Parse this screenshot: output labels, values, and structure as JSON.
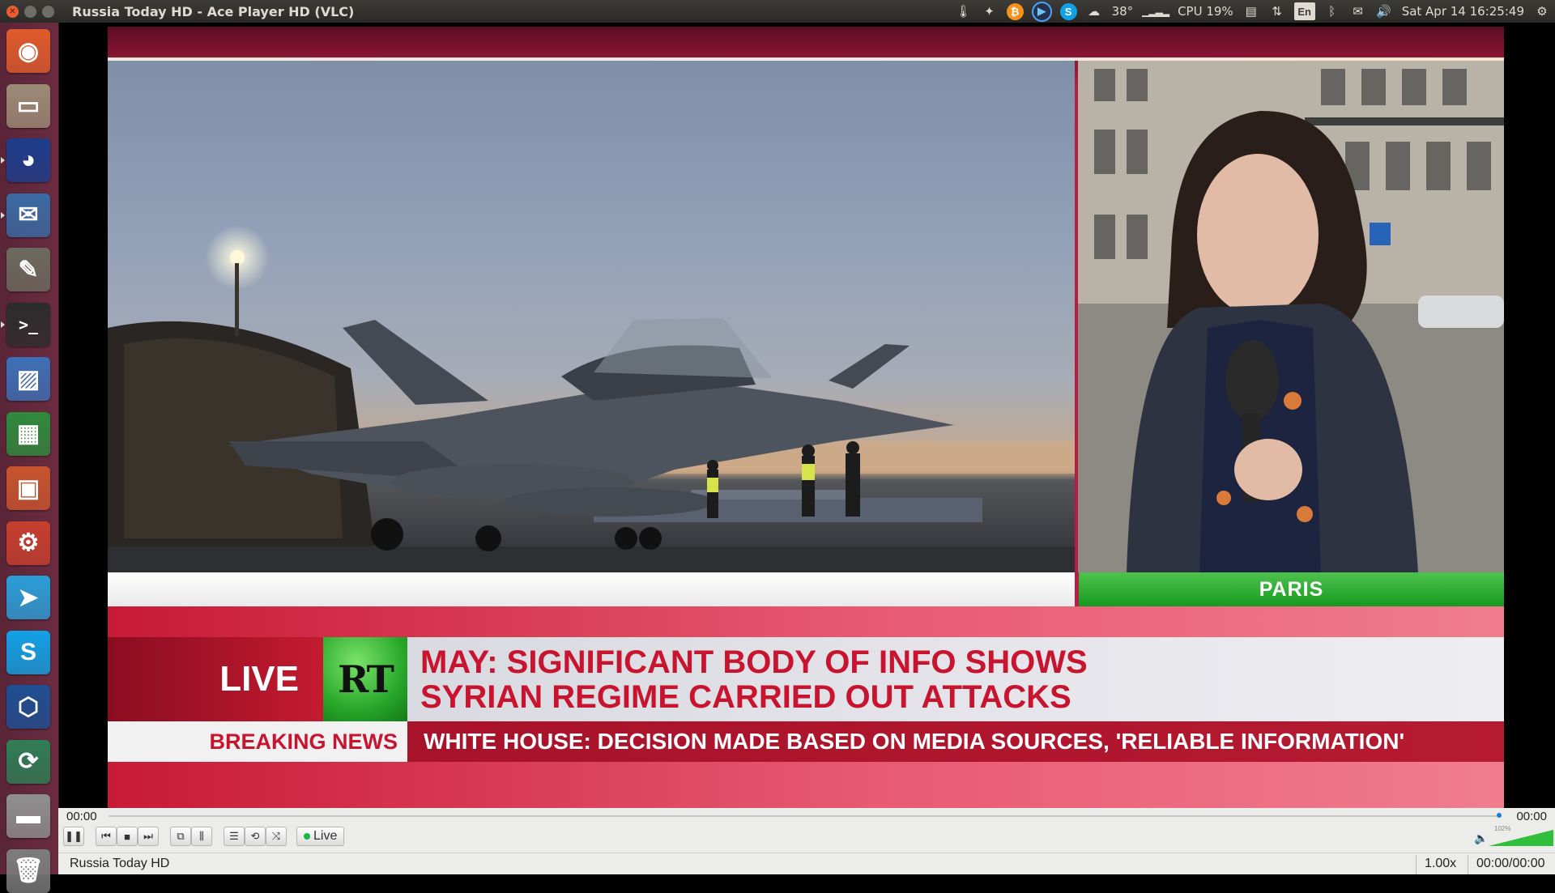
{
  "window": {
    "title": "Russia Today HD - Ace Player HD (VLC)"
  },
  "tray": {
    "weather_temp": "38°",
    "cpu": "CPU 19%",
    "keyboard_layout": "En",
    "datetime": "Sat Apr 14 16:25:49"
  },
  "launcher": {
    "items": [
      {
        "name": "ubuntu-dash-icon",
        "bg": "#e05b2c"
      },
      {
        "name": "file-manager-icon",
        "bg": "#9c8a76"
      },
      {
        "name": "firefox-icon",
        "bg": "#1c3c8c"
      },
      {
        "name": "thunderbird-icon",
        "bg": "#3a6aa4"
      },
      {
        "name": "gimp-icon",
        "bg": "#6c6a5e"
      },
      {
        "name": "terminal-icon",
        "bg": "#2c2c2c"
      },
      {
        "name": "image-viewer-icon",
        "bg": "#3d6fb6"
      },
      {
        "name": "spreadsheet-icon",
        "bg": "#2f8a3c"
      },
      {
        "name": "presentation-icon",
        "bg": "#c9542e"
      },
      {
        "name": "system-settings-icon",
        "bg": "#c63f2e"
      },
      {
        "name": "telegram-icon",
        "bg": "#2b9ed8"
      },
      {
        "name": "skype-icon",
        "bg": "#11a1e6"
      },
      {
        "name": "virtualbox-icon",
        "bg": "#1e4f93"
      },
      {
        "name": "update-manager-icon",
        "bg": "#2f7d55"
      },
      {
        "name": "disk-drive-icon",
        "bg": "#8f8f8f"
      },
      {
        "name": "trash-icon",
        "bg": "#7d7d7d"
      }
    ]
  },
  "broadcast": {
    "location": "PARIS",
    "live_label": "LIVE",
    "logo_text": "RT",
    "headline_line1": "MAY: SIGNIFICANT BODY OF INFO SHOWS",
    "headline_line2": "SYRIAN REGIME CARRIED OUT ATTACKS",
    "breaking_label": "BREAKING NEWS",
    "breaking_text": "WHITE HOUSE: DECISION MADE BASED ON MEDIA SOURCES, 'RELIABLE INFORMATION'"
  },
  "player": {
    "time_elapsed": "00:00",
    "time_total": "00:00",
    "live_button": "Live",
    "volume_percent": "102%",
    "volume_level": 1.02,
    "status_channel": "Russia Today HD",
    "status_speed": "1.00x",
    "status_time": "00:00/00:00"
  }
}
